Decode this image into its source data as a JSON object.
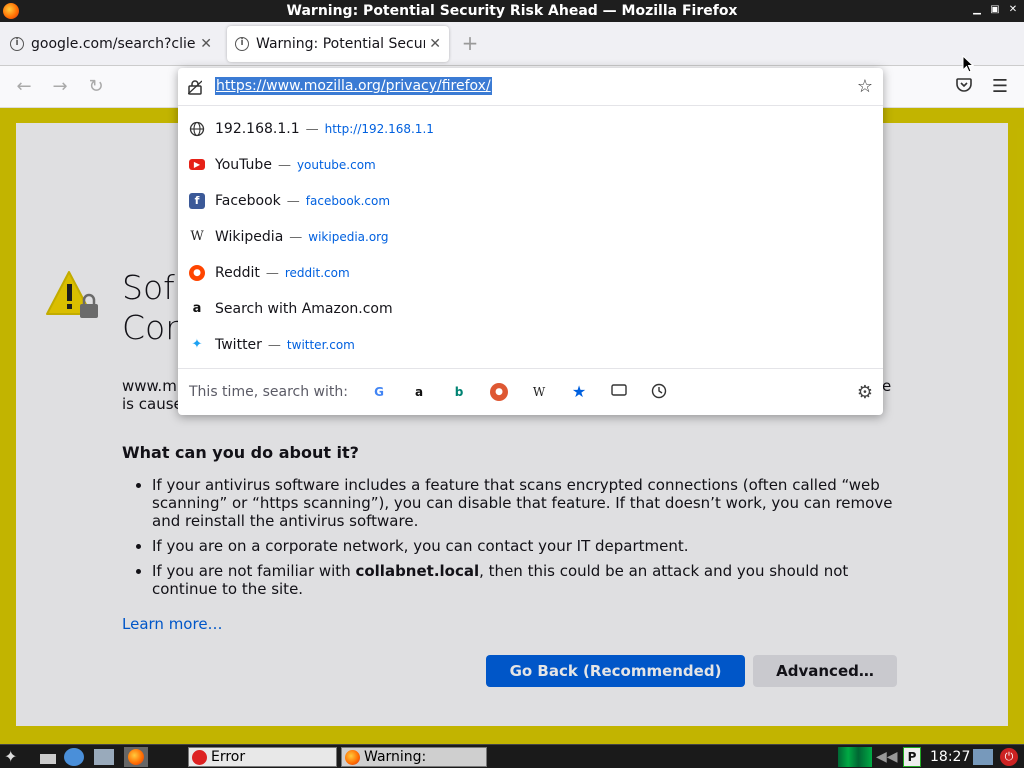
{
  "window": {
    "title": "Warning: Potential Security Risk Ahead — Mozilla Firefox",
    "controls": [
      "minimize",
      "maximize",
      "close"
    ]
  },
  "tabs": [
    {
      "label": "google.com/search?client",
      "icon": "info-icon",
      "active": false
    },
    {
      "label": "Warning: Potential Securi",
      "icon": "info-icon",
      "active": true
    }
  ],
  "new_tab_label": "+",
  "nav": {
    "back_icon": "back-arrow-icon",
    "forward_icon": "forward-arrow-icon",
    "reload_icon": "reload-icon",
    "pocket_icon": "pocket-icon",
    "menu_icon": "hamburger-menu-icon"
  },
  "urlbar": {
    "value": "https://www.mozilla.org/privacy/firefox/",
    "lock_icon": "lock-icon",
    "star_icon": "star-icon"
  },
  "suggestions": [
    {
      "title": "192.168.1.1",
      "url": "http://192.168.1.1",
      "icon": "globe-icon"
    },
    {
      "title": "YouTube",
      "url": "youtube.com",
      "icon": "youtube-icon"
    },
    {
      "title": "Facebook",
      "url": "facebook.com",
      "icon": "facebook-icon"
    },
    {
      "title": "Wikipedia",
      "url": "wikipedia.org",
      "icon": "wikipedia-icon"
    },
    {
      "title": "Reddit",
      "url": "reddit.com",
      "icon": "reddit-icon"
    },
    {
      "title": "Search with Amazon.com",
      "url": "",
      "icon": "amazon-icon"
    },
    {
      "title": "Twitter",
      "url": "twitter.com",
      "icon": "twitter-icon"
    }
  ],
  "search_with": {
    "label": "This time, search with:",
    "engines": [
      "google",
      "amazon",
      "bing",
      "duckduckgo",
      "wikipedia",
      "bookmarks",
      "tabs",
      "history"
    ]
  },
  "page": {
    "title_line1": "Sof",
    "title_line2": "Cor",
    "desc_left": "www.m",
    "desc_left2": "is cause",
    "desc_right": "e",
    "what_heading": "What can you do about it?",
    "advice": [
      "If your antivirus software includes a feature that scans encrypted connections (often called “web scanning” or “https scanning”), you can disable that feature. If that doesn’t work, you can remove and reinstall the antivirus software.",
      "If you are on a corporate network, you can contact your IT department."
    ],
    "advice3_pre": "If you are not familiar with ",
    "advice3_bold": "collabnet.local",
    "advice3_post": ", then this could be an attack and you should not continue to the site.",
    "learn_more": "Learn more…",
    "go_back": "Go Back (Recommended)",
    "advanced": "Advanced…"
  },
  "taskbar": {
    "windows": [
      {
        "label": "Error",
        "icon": "error-icon"
      },
      {
        "label": "Warning: Potenti...",
        "icon": "firefox-icon"
      }
    ],
    "clock": "18:27"
  }
}
